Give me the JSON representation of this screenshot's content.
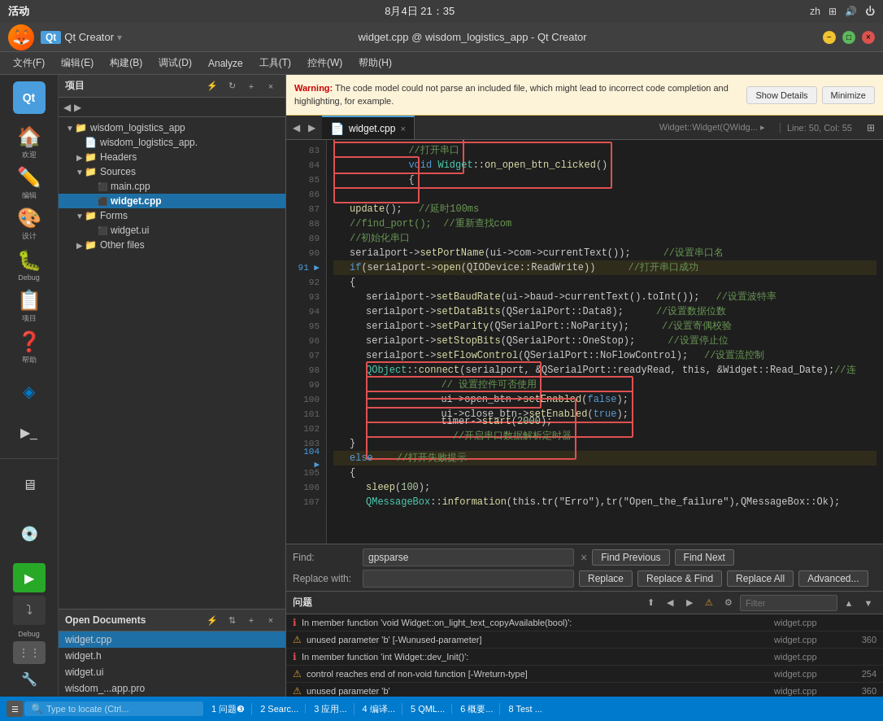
{
  "topbar": {
    "activities": "活动",
    "app_name": "Qt Creator",
    "datetime": "8月4日 21：35",
    "lang": "zh",
    "network_icon": "network",
    "sound_icon": "sound",
    "power_icon": "power"
  },
  "titlebar": {
    "title": "widget.cpp @ wisdom_logistics_app - Qt Creator"
  },
  "menubar": {
    "items": [
      "文件(F)",
      "编辑(E)",
      "构建(B)",
      "调试(D)",
      "Analyze",
      "工具(T)",
      "控件(W)",
      "帮助(H)"
    ]
  },
  "project_panel": {
    "title": "项目",
    "root": "wisdom_logistics_app",
    "root_sub": "wisdom_logistics_app.",
    "headers": "Headers",
    "sources": "Sources",
    "sources_files": [
      "main.cpp",
      "widget.cpp"
    ],
    "forms": "Forms",
    "forms_files": [
      "widget.ui"
    ],
    "other_files": "Other files"
  },
  "open_docs": {
    "title": "Open Documents",
    "files": [
      "widget.cpp",
      "widget.h",
      "widget.ui",
      "wisdom_...app.pro"
    ]
  },
  "editor": {
    "tab_label": "widget.cpp",
    "breadcrumb": "Widget::Widget(QWidg... ▸",
    "line_info": "Line: 50, Col: 55"
  },
  "warning": {
    "text": "Warning: The code model could not parse an included file, which might lead to incorrect code completion and highlighting, for example.",
    "show_details": "Show Details",
    "minimize": "Minimize"
  },
  "find_bar": {
    "find_label": "Find:",
    "find_value": "gpsparse",
    "replace_label": "Replace with:",
    "replace_value": "",
    "find_previous": "Find Previous",
    "find_next": "Find Next",
    "replace": "Replace",
    "replace_and_find": "Replace & Find",
    "replace_all": "Replace All",
    "advanced": "Advanced..."
  },
  "problems": {
    "title": "问题",
    "filter_placeholder": "Filter",
    "items": [
      {
        "type": "error",
        "text": "In member function 'void Widget::on_light_text_copyAvailable(bool)':",
        "file": "widget.cpp",
        "line": ""
      },
      {
        "type": "warn",
        "text": "unused parameter 'b' [-Wunused-parameter]",
        "file": "widget.cpp",
        "line": "360"
      },
      {
        "type": "error",
        "text": "In member function 'int Widget::dev_Init()':",
        "file": "widget.cpp",
        "line": ""
      },
      {
        "type": "warn",
        "text": "control reaches end of non-void function [-Wreturn-type]",
        "file": "widget.cpp",
        "line": "254"
      },
      {
        "type": "warn",
        "text": "unused parameter 'b'",
        "file": "widget.cpp",
        "line": "360"
      }
    ]
  },
  "statusbar": {
    "search_placeholder": "Type to locate (Ctrl...",
    "tabs": [
      "1 问题❸",
      "2 Searc...",
      "3 应用...",
      "4 编译...",
      "5 QML...",
      "6 概要...",
      "8 Test ..."
    ]
  },
  "app_icons": [
    {
      "label": "欢迎",
      "symbol": "🏠"
    },
    {
      "label": "编辑",
      "symbol": "✏️"
    },
    {
      "label": "设计",
      "symbol": "🎨"
    },
    {
      "label": "Debug",
      "symbol": "🐞"
    },
    {
      "label": "项目",
      "symbol": "📋"
    },
    {
      "label": "帮助",
      "symbol": "❓"
    },
    {
      "label": "",
      "symbol": "🔵"
    },
    {
      "label": "Debug",
      "symbol": "💻"
    }
  ]
}
